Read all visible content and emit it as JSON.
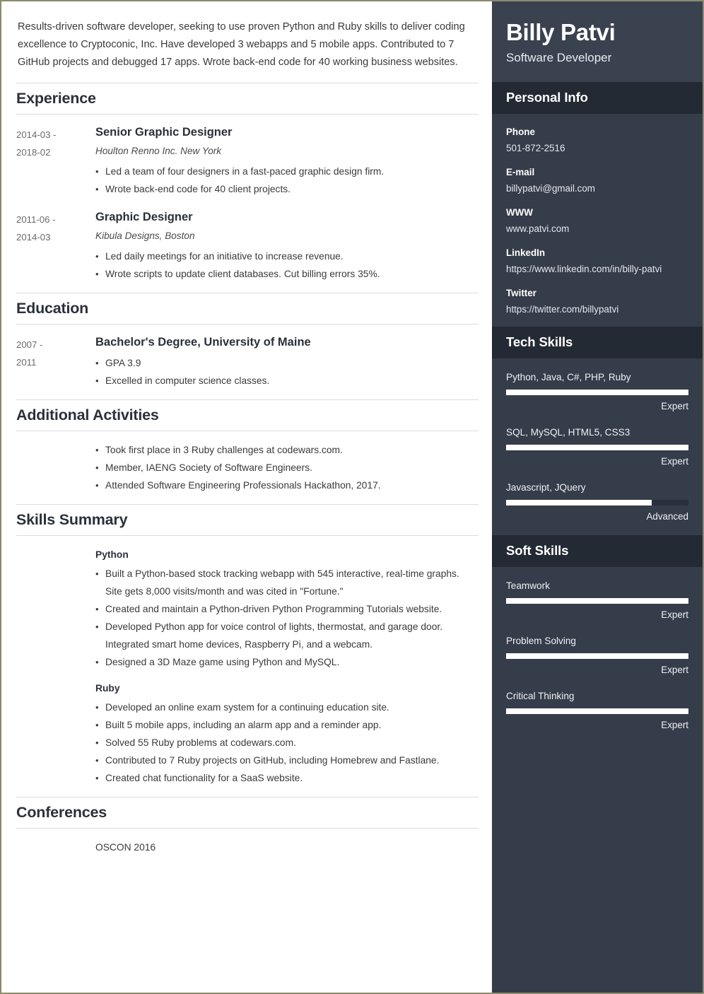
{
  "theme": {
    "page_border": "#8b8b6d",
    "sidebar_bg": "#353d4a",
    "sidebar_header_bg": "#3a4250",
    "sidebar_section_bg": "#242a33",
    "bar_fill": "#ffffff",
    "bar_track": "#2a303b",
    "heading_color": "#2b303a",
    "rule_color": "#dcdcdc"
  },
  "main": {
    "summary": "Results-driven software developer, seeking to use proven Python and Ruby skills to deliver coding excellence to Cryptoconic, Inc. Have developed 3 webapps and 5 mobile apps. Contributed to 7 GitHub projects and debugged 17 apps. Wrote back-end code for 40 working business websites.",
    "experience": {
      "heading": "Experience",
      "entries": [
        {
          "date_from": "2014-03 -",
          "date_to": "2018-02",
          "title": "Senior Graphic Designer",
          "subtitle": "Houlton Renno Inc. New York",
          "bullets": [
            "Led a team of four designers in a fast-paced graphic design firm.",
            "Wrote back-end code for 40 client projects."
          ]
        },
        {
          "date_from": "2011-06 -",
          "date_to": "2014-03",
          "title": "Graphic Designer",
          "subtitle": "Kibula Designs, Boston",
          "bullets": [
            "Led daily meetings for an initiative to increase revenue.",
            "Wrote scripts to update client databases. Cut billing errors 35%."
          ]
        }
      ]
    },
    "education": {
      "heading": "Education",
      "entries": [
        {
          "date_from": "2007 -",
          "date_to": "2011",
          "title": "Bachelor's Degree, University of Maine",
          "bullets": [
            "GPA 3.9",
            "Excelled in computer science classes."
          ]
        }
      ]
    },
    "additional_activities": {
      "heading": "Additional Activities",
      "bullets": [
        "Took first place in 3 Ruby challenges at codewars.com.",
        "Member, IAENG Society of Software Engineers.",
        "Attended Software Engineering Professionals Hackathon, 2017."
      ]
    },
    "skills_summary": {
      "heading": "Skills Summary",
      "groups": [
        {
          "title": "Python",
          "bullets": [
            "Built a Python-based stock tracking webapp with 545 interactive, real-time graphs. Site gets 8,000 visits/month and was cited in \"Fortune.\"",
            "Created and maintain a Python-driven Python Programming Tutorials website.",
            "Developed Python app for voice control of lights, thermostat, and garage door. Integrated smart home devices, Raspberry Pi, and a webcam.",
            "Designed a 3D Maze game using Python and MySQL."
          ]
        },
        {
          "title": "Ruby",
          "bullets": [
            "Developed an online exam system for a continuing education site.",
            "Built 5 mobile apps, including an alarm app and a reminder app.",
            "Solved 55 Ruby problems at codewars.com.",
            "Contributed to 7 Ruby projects on GitHub, including Homebrew and Fastlane.",
            "Created chat functionality for a SaaS website."
          ]
        }
      ]
    },
    "conferences": {
      "heading": "Conferences",
      "items": [
        "OSCON 2016"
      ]
    }
  },
  "sidebar": {
    "name": "Billy Patvi",
    "role": "Software Developer",
    "personal_info": {
      "heading": "Personal Info",
      "items": [
        {
          "label": "Phone",
          "value": "501-872-2516"
        },
        {
          "label": "E-mail",
          "value": "billypatvi@gmail.com"
        },
        {
          "label": "WWW",
          "value": "www.patvi.com"
        },
        {
          "label": "LinkedIn",
          "value": "https://www.linkedin.com/in/billy-patvi"
        },
        {
          "label": "Twitter",
          "value": "https://twitter.com/billypatvi"
        }
      ]
    },
    "tech_skills": {
      "heading": "Tech Skills",
      "items": [
        {
          "name": "Python, Java, C#, PHP, Ruby",
          "level": "Expert",
          "percent": 100
        },
        {
          "name": "SQL, MySQL, HTML5, CSS3",
          "level": "Expert",
          "percent": 100
        },
        {
          "name": "Javascript, JQuery",
          "level": "Advanced",
          "percent": 80
        }
      ]
    },
    "soft_skills": {
      "heading": "Soft Skills",
      "items": [
        {
          "name": "Teamwork",
          "level": "Expert",
          "percent": 100
        },
        {
          "name": "Problem Solving",
          "level": "Expert",
          "percent": 100
        },
        {
          "name": "Critical Thinking",
          "level": "Expert",
          "percent": 100
        }
      ]
    }
  }
}
